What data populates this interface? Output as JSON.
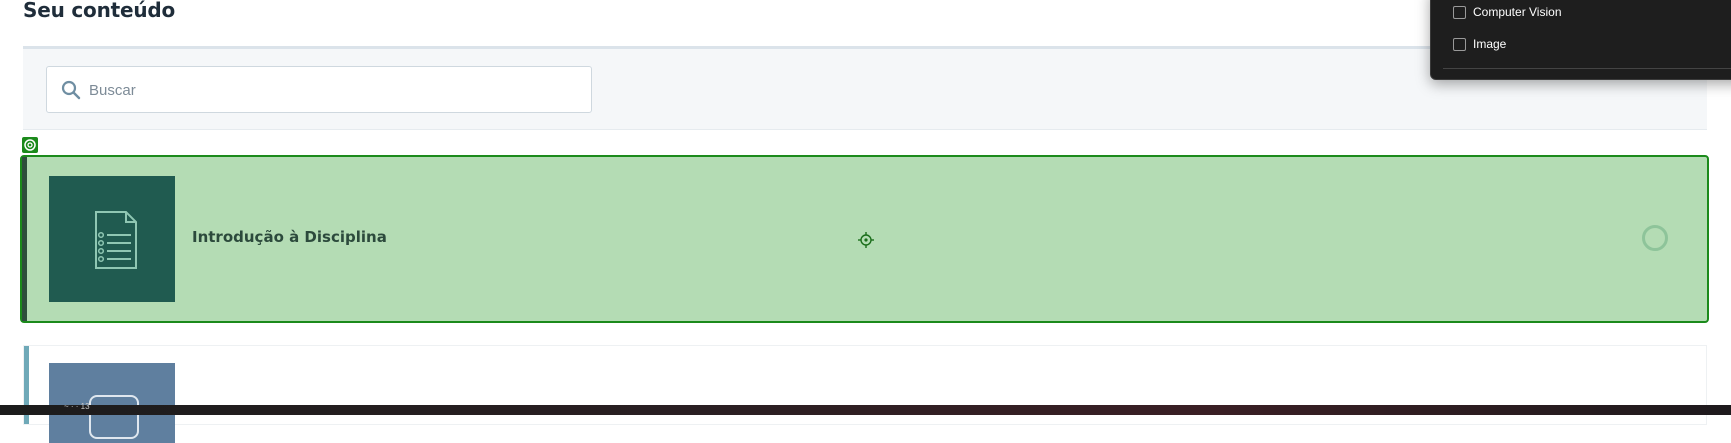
{
  "page": {
    "title": "Seu conteúdo"
  },
  "search": {
    "placeholder": "Buscar",
    "value": ""
  },
  "content_items": [
    {
      "title": "Introdução à Disciplina",
      "icon": "document-list-icon",
      "selected": true
    },
    {
      "title": "",
      "icon": "chat-bubble-icon",
      "selected": false
    }
  ],
  "filter_dropdown": {
    "options": [
      {
        "label": "Computer Vision",
        "checked": false
      },
      {
        "label": "Image",
        "checked": false
      }
    ]
  },
  "taskbar": {
    "text": "~ · · 13"
  },
  "colors": {
    "selected_card_bg": "#b4dcb4",
    "selected_border": "#1b8a1b",
    "doc_thumb_bg": "#205b50",
    "accent_bar": "#6fa9b8",
    "dropdown_bg": "#1e1e1e"
  }
}
